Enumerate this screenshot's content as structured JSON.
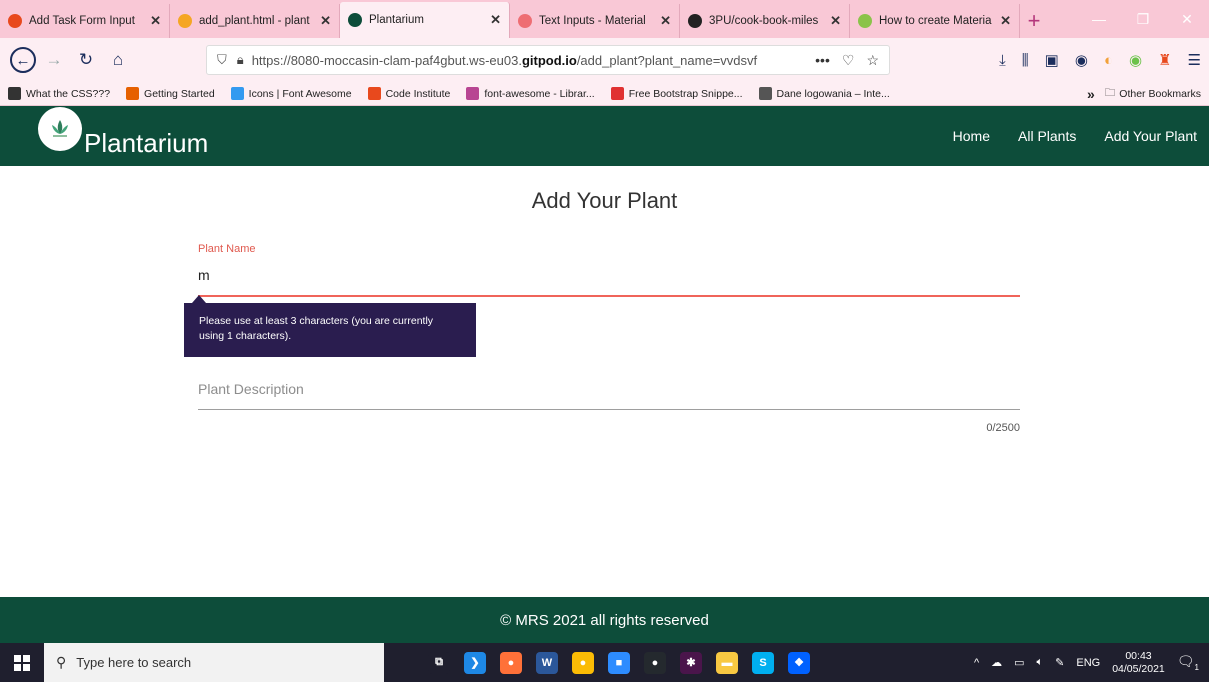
{
  "browser": {
    "tabs": [
      {
        "title": "Add Task Form Input",
        "color": "#e8491d",
        "active": false,
        "dim": false
      },
      {
        "title": "add_plant.html - plant",
        "color": "#f5a623",
        "active": false,
        "dim": false
      },
      {
        "title": "Plantarium",
        "color": "#0d4d3a",
        "active": true,
        "dim": false
      },
      {
        "title": "Text Inputs - Material",
        "color": "#ee6e73",
        "active": false,
        "dim": false
      },
      {
        "title": "3PU/cook-book-miles",
        "color": "#222222",
        "active": false,
        "dim": false
      },
      {
        "title": "How to create Materia",
        "color": "#8bc34a",
        "active": false,
        "dim": false
      }
    ],
    "close_glyph": "✕",
    "new_tab": "+",
    "url_plain_start": "https://8080-moccasin-clam-paf4gbut.ws-eu03.",
    "url_bold": "gitpod.io",
    "url_plain_end": "/add_plant?plant_name=vvdsvf",
    "url_more": "•••",
    "bookmarks": [
      {
        "label": "What the CSS???",
        "color": "#333333"
      },
      {
        "label": "Getting Started",
        "color": "#e66000"
      },
      {
        "label": "Icons | Font Awesome",
        "color": "#339af0"
      },
      {
        "label": "Code Institute",
        "color": "#e8491d"
      },
      {
        "label": "font-awesome - Librar...",
        "color": "#b84592"
      },
      {
        "label": "Free Bootstrap Snippe...",
        "color": "#e03131"
      },
      {
        "label": "Dane logowania – Inte...",
        "color": "#555555"
      }
    ],
    "bookmarks_overflow": "»",
    "other_bookmarks": "Other Bookmarks"
  },
  "site": {
    "brand": "Plantarium",
    "nav": [
      "Home",
      "All Plants",
      "Add Your Plant"
    ],
    "colors": {
      "primary": "#0d4d3a",
      "error": "#f0645a",
      "tooltip": "#2a1d4f"
    }
  },
  "form": {
    "heading": "Add Your Plant",
    "plant_name_label": "Plant Name",
    "plant_name_value": "m",
    "validation_tooltip": "Please use at least 3 characters (you are currently using 1 characters).",
    "description_placeholder": "Plant Description",
    "char_counter": "0/2500"
  },
  "footer": {
    "text": "© MRS 2021 all rights reserved"
  },
  "taskbar": {
    "search_placeholder": "Type here to search",
    "apps": [
      {
        "name": "task-view-icon",
        "color": "#1f1f2e",
        "glyph": "⧉"
      },
      {
        "name": "vscode-icon",
        "color": "#1e88e5",
        "glyph": "❯"
      },
      {
        "name": "firefox-icon",
        "color": "#ff7139",
        "glyph": "●"
      },
      {
        "name": "word-icon",
        "color": "#2b579a",
        "glyph": "W"
      },
      {
        "name": "chrome-icon",
        "color": "#fbbc05",
        "glyph": "●"
      },
      {
        "name": "zoom-icon",
        "color": "#2d8cff",
        "glyph": "■"
      },
      {
        "name": "github-icon",
        "color": "#24292e",
        "glyph": "●"
      },
      {
        "name": "slack-icon",
        "color": "#4a154b",
        "glyph": "✱"
      },
      {
        "name": "explorer-icon",
        "color": "#f8c842",
        "glyph": "▬"
      },
      {
        "name": "skype-icon",
        "color": "#00aff0",
        "glyph": "S"
      },
      {
        "name": "dropbox-icon",
        "color": "#0061ff",
        "glyph": "❖"
      }
    ],
    "lang": "ENG",
    "time": "00:43",
    "date": "04/05/2021",
    "notification_count": "1"
  }
}
